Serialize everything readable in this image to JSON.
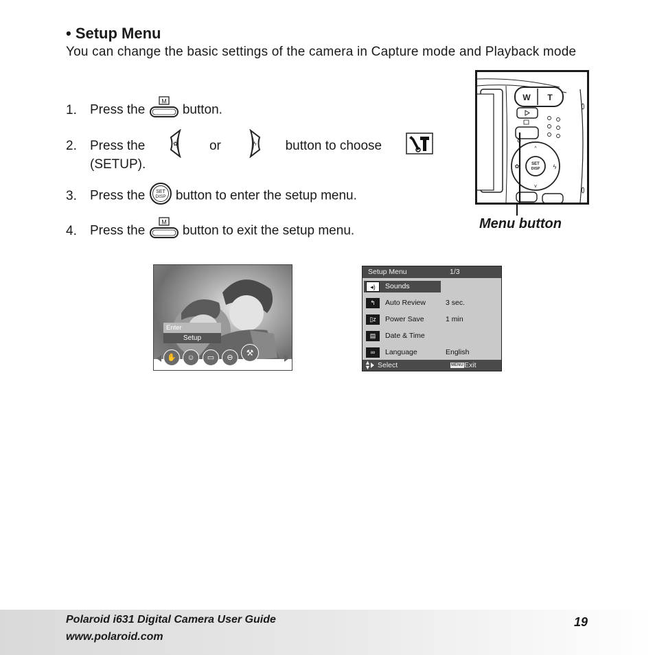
{
  "section": {
    "title": "• Setup Menu",
    "intro": "You can change the basic settings of the camera in Capture mode and Playback mode"
  },
  "steps": [
    {
      "num": "1.",
      "before": "Press the",
      "after": "button.",
      "icon": "menu-button-icon"
    },
    {
      "num": "2.",
      "before": "Press the",
      "or": "or",
      "mid": "button to choose",
      "cont": "(SETUP).",
      "icons": [
        "left-macro-button-icon",
        "right-flash-button-icon",
        "setup-tools-icon"
      ]
    },
    {
      "num": "3.",
      "before": "Press the",
      "after": "button to enter the setup menu.",
      "icon": "set-disp-button-icon"
    },
    {
      "num": "4.",
      "before": "Press the",
      "after": "button to exit the setup menu.",
      "icon": "menu-button-icon"
    }
  ],
  "icon_text": {
    "menu_m": "M",
    "set": "SET",
    "disp": "DISP"
  },
  "camera_illustration": {
    "caption": "Menu button",
    "labels": {
      "w": "W",
      "t": "T",
      "set": "SET",
      "disp": "DISP"
    }
  },
  "photo_screen": {
    "menu_items": [
      "Enter",
      "Setup"
    ],
    "mode_icons": [
      "stabilizer-icon",
      "face-detect-icon",
      "frame-icon",
      "zoom-icon",
      "setup-icon"
    ]
  },
  "setup_screen": {
    "title": "Setup Menu",
    "page": "1/3",
    "rows": [
      {
        "icon": "speaker-icon",
        "label": "Sounds",
        "value": "",
        "selected": true
      },
      {
        "icon": "auto-review-icon",
        "label": "Auto Review",
        "value": "3 sec.",
        "selected": false
      },
      {
        "icon": "power-save-icon",
        "label": "Power Save",
        "value": "1 min",
        "selected": false
      },
      {
        "icon": "date-time-icon",
        "label": "Date & Time",
        "value": "",
        "selected": false
      },
      {
        "icon": "language-icon",
        "label": "Language",
        "value": "English",
        "selected": false
      }
    ],
    "footer": {
      "select": "Select",
      "menu_tag": "MENU",
      "exit": "Exit"
    }
  },
  "footer": {
    "title": "Polaroid i631 Digital Camera User Guide",
    "url": "www.polaroid.com",
    "page": "19"
  }
}
